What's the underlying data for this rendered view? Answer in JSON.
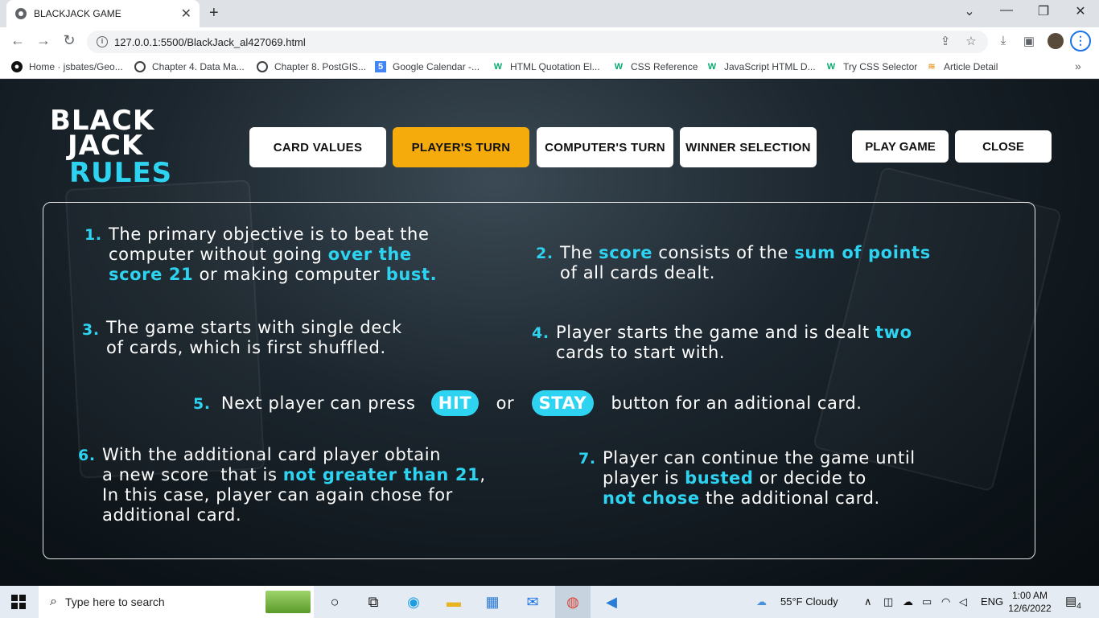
{
  "browser": {
    "tab_title": "BLACKJACK GAME",
    "url": "127.0.0.1:5500/BlackJack_al427069.html",
    "bookmarks": [
      {
        "label": "Home · jsbates/Geo..."
      },
      {
        "label": "Chapter 4. Data Ma..."
      },
      {
        "label": "Chapter 8. PostGIS..."
      },
      {
        "label": "Google Calendar -..."
      },
      {
        "label": "HTML Quotation El..."
      },
      {
        "label": "CSS Reference"
      },
      {
        "label": "JavaScript HTML D..."
      },
      {
        "label": "Try CSS Selector"
      },
      {
        "label": "Article Detail"
      }
    ]
  },
  "logo": {
    "line1": "BLACK",
    "line2": "JACK",
    "line3": "RULES"
  },
  "nav": {
    "card_values": "CARD VALUES",
    "players_turn": "PLAYER'S TURN",
    "computers_turn": "COMPUTER'S TURN",
    "winner_selection": "WINNER SELECTION",
    "play_game": "PLAY GAME",
    "close": "CLOSE"
  },
  "rules": {
    "r1": {
      "num": "1.",
      "a": "The primary objective is to beat the",
      "b": "computer without going ",
      "b_hl": "over the",
      "c_hl": "score 21",
      "c": " or making computer ",
      "c_hl2": "bust."
    },
    "r2": {
      "num": "2.",
      "a": "The ",
      "a_hl": "score",
      "a2": " consists of the ",
      "a_hl2": "sum of points",
      "b": "of all cards dealt."
    },
    "r3": {
      "num": "3.",
      "a": "The game starts with single deck",
      "b": "of cards, which is first shuffled."
    },
    "r4": {
      "num": "4.",
      "a": "Player starts the game and is dealt ",
      "a_hl": "two",
      "b": "cards to start with."
    },
    "r5": {
      "num": "5.",
      "a": "Next player can press",
      "hit": "HIT",
      "or": "or",
      "stay": "STAY",
      "b": "button for an aditional card."
    },
    "r6": {
      "num": "6.",
      "a": "With the additional card player obtain",
      "b": "a new score  that is ",
      "b_hl": "not greater than 21",
      "b2": ",",
      "c": "In this case, player can again chose for",
      "d": "additional card."
    },
    "r7": {
      "num": "7.",
      "a": "Player can continue the game until",
      "b": "player is ",
      "b_hl": "busted",
      "b2": " or decide to",
      "c_hl": "not chose",
      "c": " the additional card."
    }
  },
  "taskbar": {
    "search_placeholder": "Type here to search",
    "weather": "55°F  Cloudy",
    "lang": "ENG",
    "time": "1:00 AM",
    "date": "12/6/2022",
    "notifications": "4"
  }
}
